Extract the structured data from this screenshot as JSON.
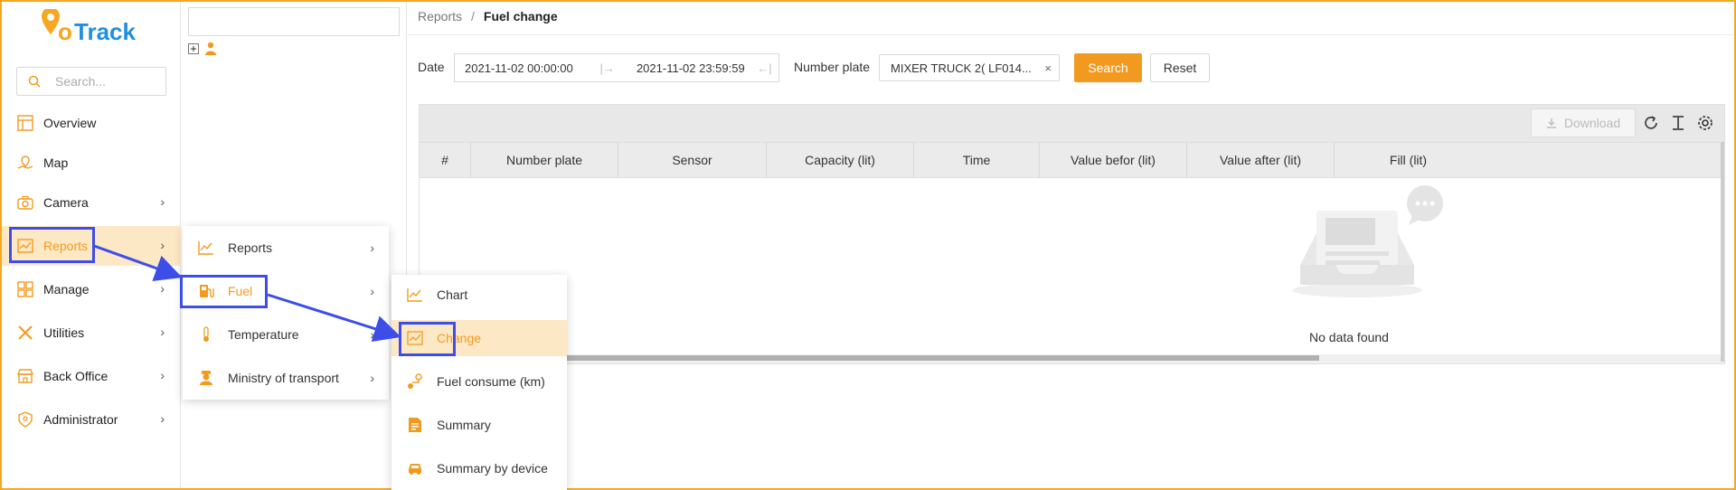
{
  "brand": {
    "name": "GoTrack",
    "accent": "#f29a1f",
    "highlight": "#3d4ee8"
  },
  "sidebar": {
    "search_placeholder": "Search...",
    "items": [
      {
        "label": "Overview",
        "icon": "overview-icon"
      },
      {
        "label": "Map",
        "icon": "map-icon"
      },
      {
        "label": "Camera",
        "icon": "camera-icon"
      },
      {
        "label": "Reports",
        "icon": "reports-icon"
      },
      {
        "label": "Manage",
        "icon": "manage-icon"
      },
      {
        "label": "Utilities",
        "icon": "utilities-icon"
      },
      {
        "label": "Back Office",
        "icon": "back-office-icon"
      },
      {
        "label": "Administrator",
        "icon": "administrator-icon"
      }
    ]
  },
  "submenu_reports": {
    "items": [
      {
        "label": "Reports",
        "icon": "line-chart-icon"
      },
      {
        "label": "Fuel",
        "icon": "fuel-pump-icon"
      },
      {
        "label": "Temperature",
        "icon": "thermometer-icon"
      },
      {
        "label": "Ministry of transport",
        "icon": "officer-icon"
      }
    ]
  },
  "submenu_fuel": {
    "items": [
      {
        "label": "Chart",
        "icon": "line-chart-icon"
      },
      {
        "label": "Change",
        "icon": "area-chart-icon"
      },
      {
        "label": "Fuel consume (km)",
        "icon": "route-icon"
      },
      {
        "label": "Summary",
        "icon": "document-icon"
      },
      {
        "label": "Summary by device",
        "icon": "car-icon"
      }
    ]
  },
  "breadcrumb": {
    "parent": "Reports",
    "separator": "/",
    "current": "Fuel change"
  },
  "filters": {
    "date_label": "Date",
    "date_start": "2021-11-02 00:00:00",
    "date_end": "2021-11-02 23:59:59",
    "plate_label": "Number plate",
    "plate_value": "MIXER TRUCK 2( LF014...",
    "search_label": "Search",
    "reset_label": "Reset"
  },
  "toolbar": {
    "download_label": "Download"
  },
  "table": {
    "columns": [
      "#",
      "Number plate",
      "Sensor",
      "Capacity (lit)",
      "Time",
      "Value befor (lit)",
      "Value after (lit)",
      "Fill (lit)"
    ],
    "empty_text": "No data found"
  }
}
